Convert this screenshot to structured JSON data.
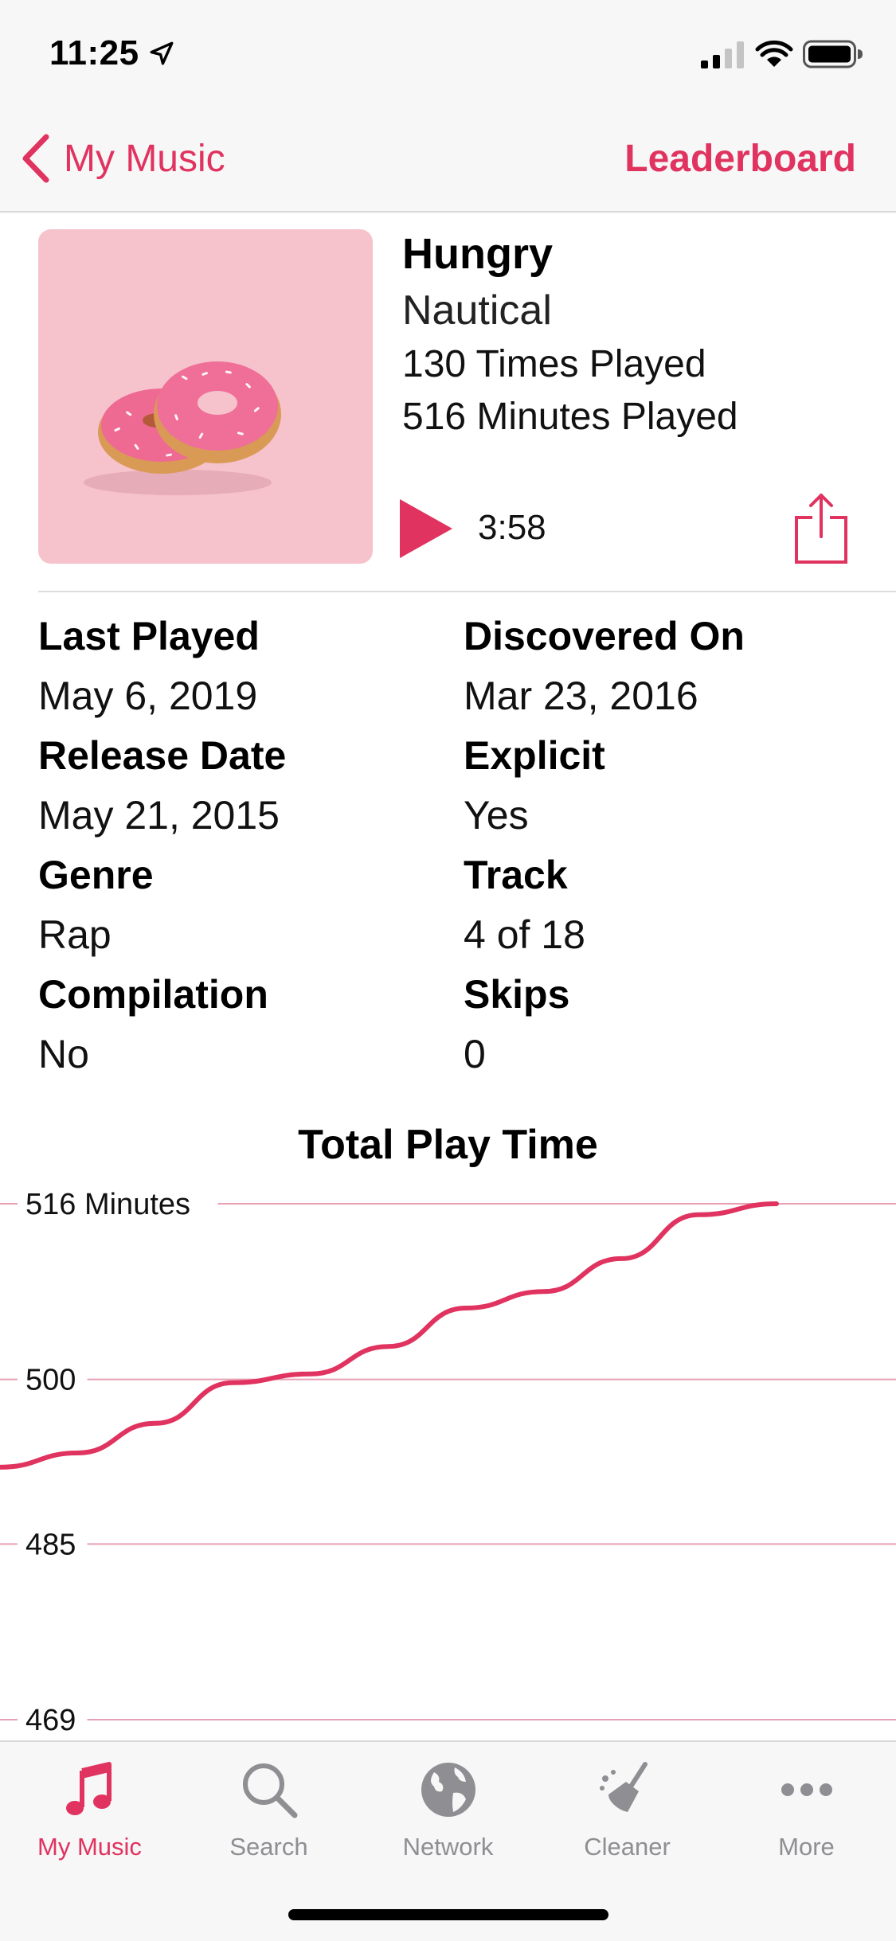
{
  "status_bar": {
    "time": "11:25"
  },
  "nav": {
    "back_label": "My Music",
    "right_action": "Leaderboard"
  },
  "song": {
    "title": "Hungry",
    "artist": "Nautical",
    "times_played": "130 Times Played",
    "minutes_played": "516 Minutes Played",
    "duration": "3:58"
  },
  "details": [
    {
      "label": "Last Played",
      "value": "May 6, 2019"
    },
    {
      "label": "Discovered On",
      "value": "Mar 23, 2016"
    },
    {
      "label": "Release Date",
      "value": "May 21, 2015"
    },
    {
      "label": "Explicit",
      "value": "Yes"
    },
    {
      "label": "Genre",
      "value": "Rap"
    },
    {
      "label": "Track",
      "value": "4 of 18"
    },
    {
      "label": "Compilation",
      "value": "No"
    },
    {
      "label": "Skips",
      "value": "0"
    }
  ],
  "colors": {
    "accent": "#e0335f",
    "artwork_bg": "#f6c2cc",
    "gridline": "#e8a0b4"
  },
  "chart_data": {
    "type": "line",
    "title": "Total Play Time",
    "y_tick_labels": [
      "516 Minutes",
      "500",
      "485",
      "469"
    ],
    "y_ticks": [
      516,
      500,
      485,
      469
    ],
    "ylim": [
      469,
      516
    ],
    "grid": true,
    "series": [
      {
        "values": [
          492,
          493.3,
          496,
          499.7,
          500.5,
          503,
          506.5,
          508,
          511,
          515,
          516
        ]
      }
    ]
  },
  "tabs": [
    {
      "label": "My Music",
      "icon": "music-note-icon",
      "active": true
    },
    {
      "label": "Search",
      "icon": "magnifier-icon",
      "active": false
    },
    {
      "label": "Network",
      "icon": "globe-icon",
      "active": false
    },
    {
      "label": "Cleaner",
      "icon": "broom-icon",
      "active": false
    },
    {
      "label": "More",
      "icon": "ellipsis-icon",
      "active": false
    }
  ]
}
